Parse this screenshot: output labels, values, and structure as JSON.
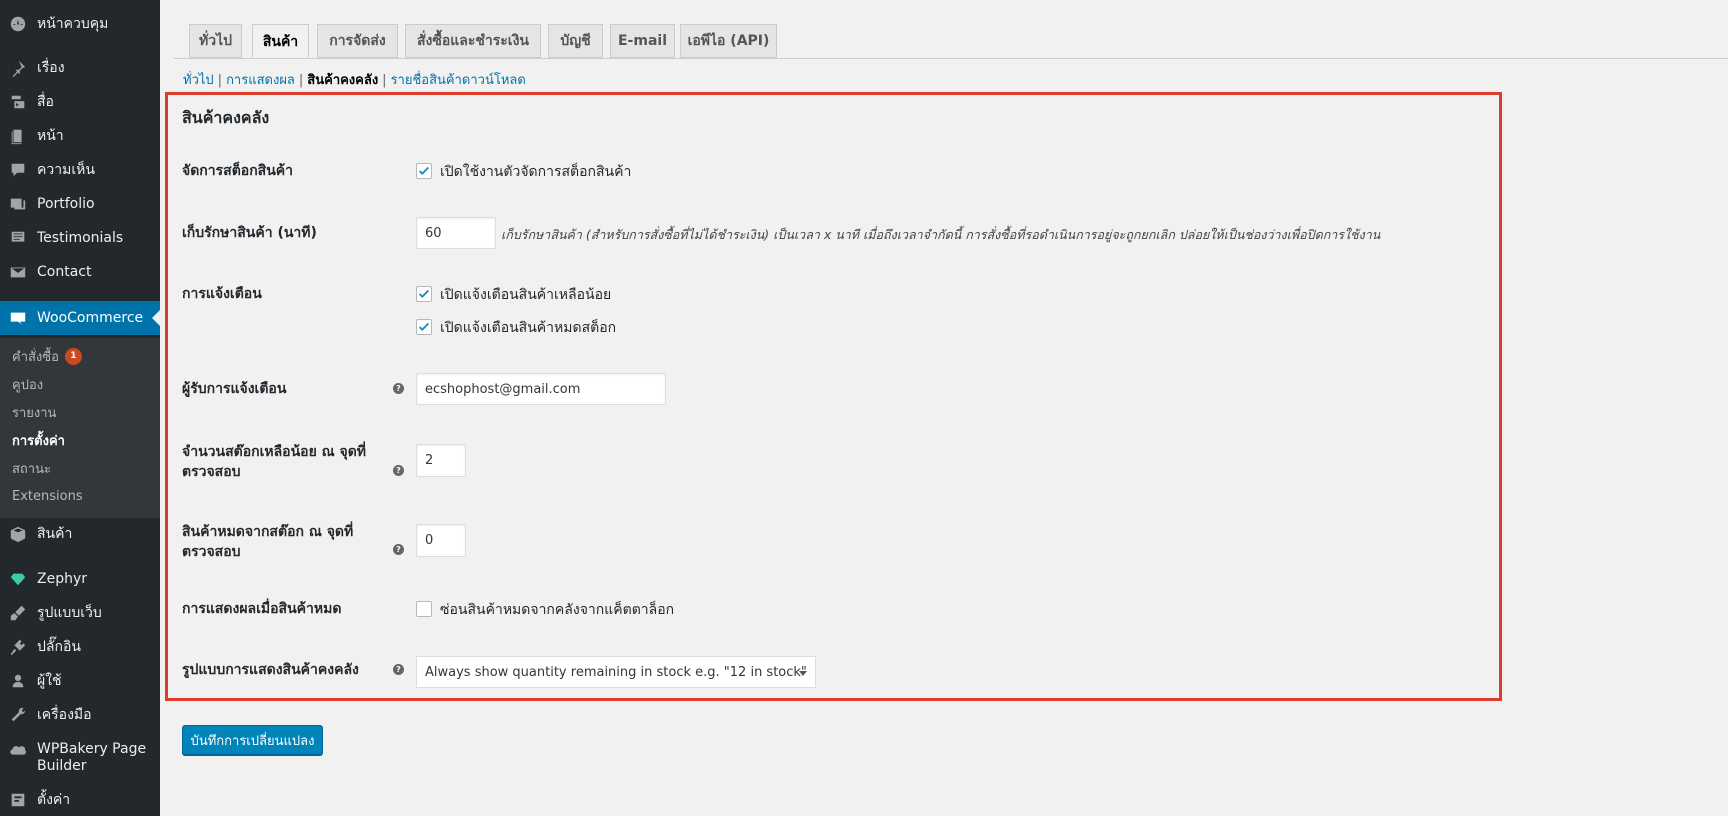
{
  "sidebar": {
    "items": [
      {
        "label": "หน้าควบคุม",
        "icon": "dashboard-icon"
      },
      {
        "label": "เรื่อง",
        "icon": "pin-icon"
      },
      {
        "label": "สื่อ",
        "icon": "media-icon"
      },
      {
        "label": "หน้า",
        "icon": "page-icon"
      },
      {
        "label": "ความเห็น",
        "icon": "comment-icon"
      },
      {
        "label": "Portfolio",
        "icon": "portfolio-icon"
      },
      {
        "label": "Testimonials",
        "icon": "testimonial-icon"
      },
      {
        "label": "Contact",
        "icon": "mail-icon"
      },
      {
        "label": "WooCommerce",
        "icon": "woocommerce-icon"
      },
      {
        "label": "สินค้า",
        "icon": "box-icon"
      },
      {
        "label": "Zephyr",
        "icon": "gem-icon"
      },
      {
        "label": "รูปแบบเว็บ",
        "icon": "brush-icon"
      },
      {
        "label": "ปลั๊กอิน",
        "icon": "plugin-icon"
      },
      {
        "label": "ผู้ใช้",
        "icon": "user-icon"
      },
      {
        "label": "เครื่องมือ",
        "icon": "wrench-icon"
      },
      {
        "label_line1": "WPBakery Page",
        "label_line2": "Builder",
        "icon": "wpbakery-icon"
      },
      {
        "label": "ตั้งค่า",
        "icon": "settings-icon"
      }
    ],
    "woo_submenu": [
      {
        "label": "คำสั่งซื้อ",
        "badge": "1"
      },
      {
        "label": "คูปอง"
      },
      {
        "label": "รายงาน"
      },
      {
        "label": "การตั้งค่า"
      },
      {
        "label": "สถานะ"
      },
      {
        "label": "Extensions"
      }
    ]
  },
  "tabs": [
    "ทั่วไป",
    "สินค้า",
    "การจัดส่ง",
    "สั่งซื้อและชำระเงิน",
    "บัญชี",
    "E-mail",
    "เอพีไอ (API)"
  ],
  "active_tab": "สินค้า",
  "subsections": [
    "ทั่วไป",
    "การแสดงผล",
    "สินค้าคงคลัง",
    "รายชื่อสินค้าดาวน์โหลด"
  ],
  "current_subsection": "สินค้าคงคลัง",
  "section_title": "สินค้าคงคลัง",
  "settings": {
    "manage_stock": {
      "label": "จัดการสต็อกสินค้า",
      "checkbox_label": "เปิดใช้งานตัวจัดการสต็อกสินค้า",
      "checked": true
    },
    "hold_stock": {
      "label": "เก็บรักษาสินค้า (นาที)",
      "value": "60",
      "description": "เก็บรักษาสินค้า (สำหรับการสั่งซื้อที่ไม่ได้ชำระเงิน) เป็นเวลา x นาที เมื่อถึงเวลาจำกัดนี้ การสั่งซื้อที่รอดำเนินการอยู่จะถูกยกเลิก ปล่อยให้เป็นช่องว่างเพื่อปิดการใช้งาน"
    },
    "notifications": {
      "label": "การแจ้งเตือน",
      "low_stock_label": "เปิดแจ้งเตือนสินค้าเหลือน้อย",
      "low_stock_checked": true,
      "out_of_stock_label": "เปิดแจ้งเตือนสินค้าหมดสต็อก",
      "out_of_stock_checked": true
    },
    "recipient": {
      "label": "ผู้รับการแจ้งเตือน",
      "value": "ecshophost@gmail.com"
    },
    "low_threshold": {
      "label_line1": "จำนวนสต๊อกเหลือน้อย ณ จุดที่",
      "label_line2": "ตรวจสอบ",
      "value": "2"
    },
    "out_threshold": {
      "label_line1": "สินค้าหมดจากสต๊อก ณ จุดที่",
      "label_line2": "ตรวจสอบ",
      "value": "0"
    },
    "out_of_stock_visibility": {
      "label": "การแสดงผลเมื่อสินค้าหมด",
      "checkbox_label": "ซ่อนสินค้าหมดจากคลังจากแค็ตตาล็อก",
      "checked": false
    },
    "stock_format": {
      "label": "รูปแบบการแสดงสินค้าคงคลัง",
      "selected": "Always show quantity remaining in stock e.g. \"12 in stock\""
    }
  },
  "save_button": "บันทึกการเปลี่ยนแปลง",
  "colors": {
    "accent": "#0073aa",
    "highlight_border": "#dd3d2f",
    "sidebar_bg": "#23282d",
    "badge": "#ca4a1f"
  }
}
